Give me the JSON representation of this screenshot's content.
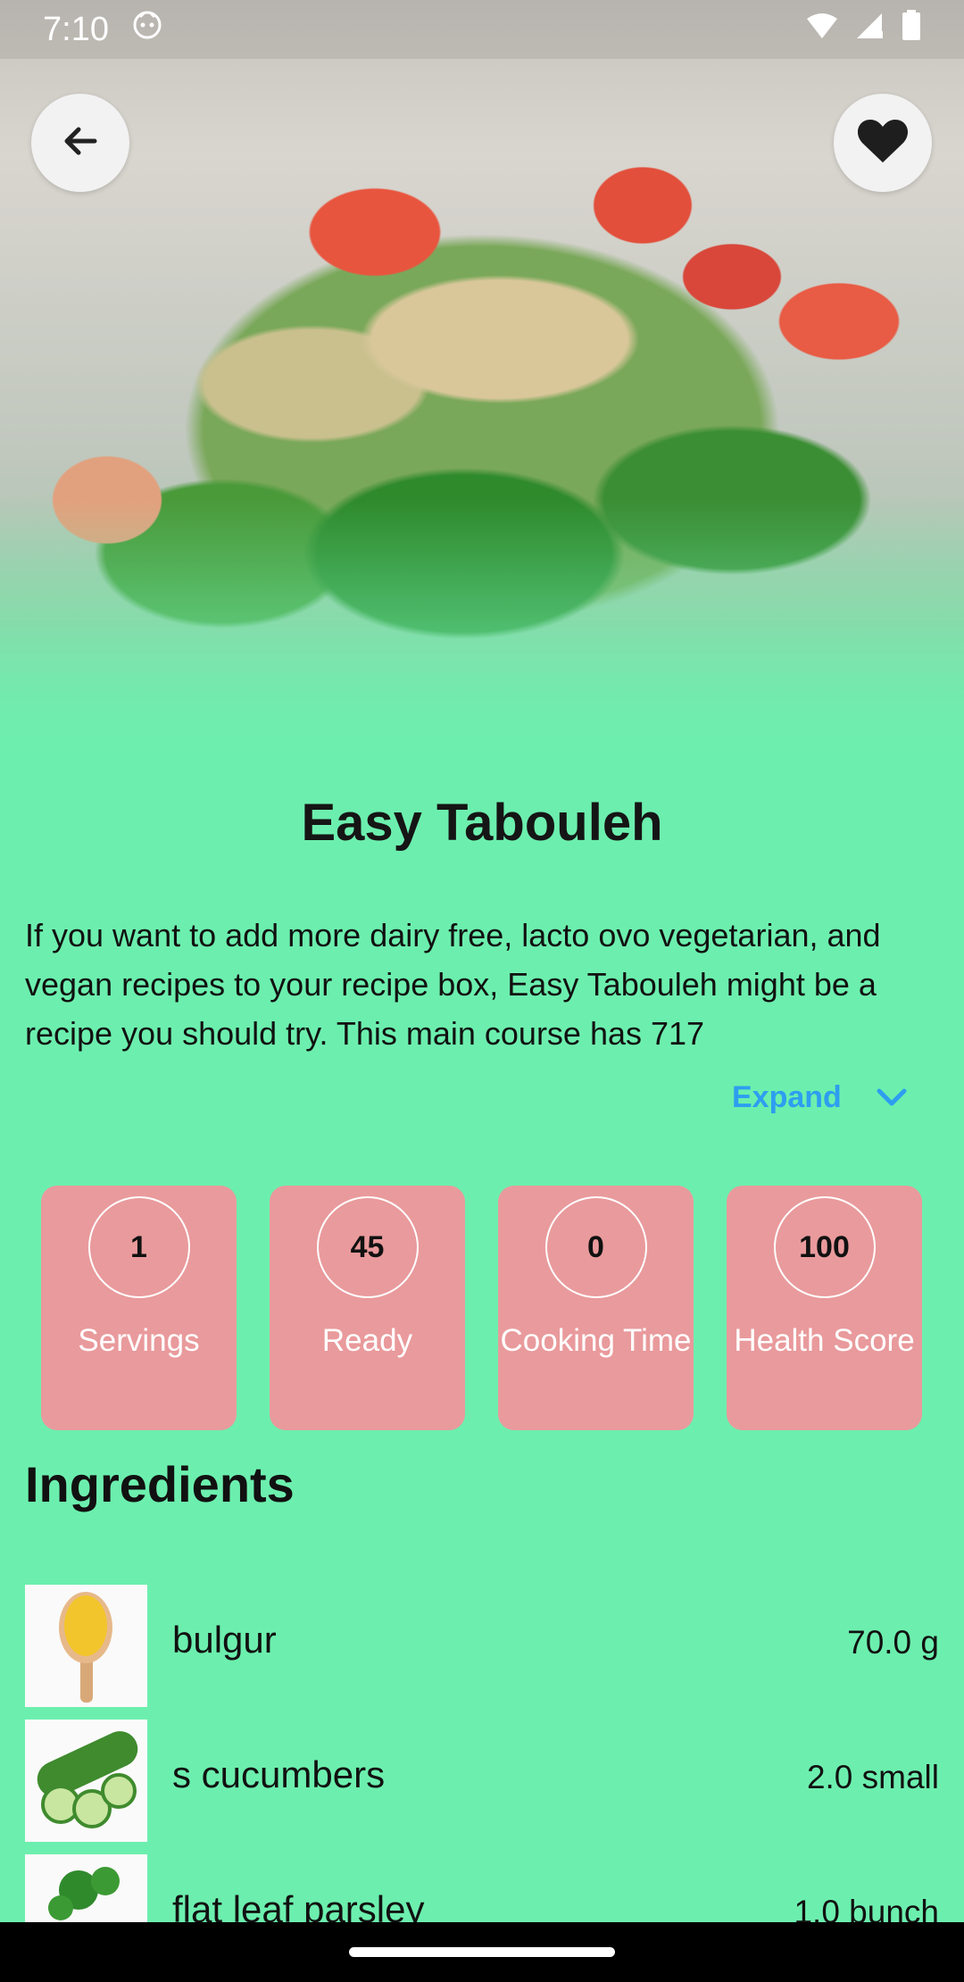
{
  "status_bar": {
    "time": "7:10"
  },
  "recipe": {
    "title": "Easy Tabouleh",
    "summary": "If you want to add more dairy free, lacto ovo vegetarian, and vegan recipes to your recipe box, Easy Tabouleh might be a recipe you should try. This main course has 717",
    "expand_label": "Expand"
  },
  "stats": [
    {
      "value": "1",
      "label": "Servings"
    },
    {
      "value": "45",
      "label": "Ready"
    },
    {
      "value": "0",
      "label": "Cooking Time"
    },
    {
      "value": "100",
      "label": "Health Score"
    }
  ],
  "ingredients_title": "Ingredients",
  "ingredients": [
    {
      "name": "bulgur",
      "amount": "70.0 g"
    },
    {
      "name": "s cucumbers",
      "amount": "2.0 small"
    },
    {
      "name": "flat leaf parsley",
      "amount": "1.0 bunch"
    }
  ],
  "colors": {
    "background": "#6cefae",
    "card": "#e99a9c",
    "accent": "#2d9ef0"
  },
  "icons": {
    "back": "arrow-back-icon",
    "favorite": "heart-icon",
    "expand": "chevron-down-icon"
  }
}
